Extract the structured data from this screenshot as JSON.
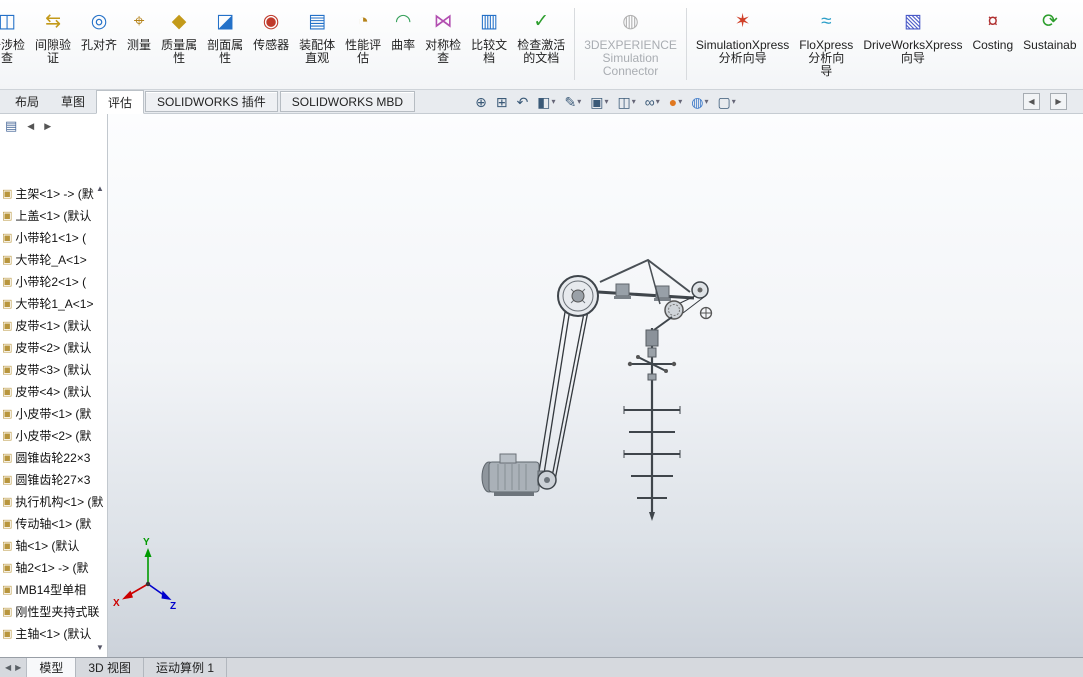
{
  "icons": {
    "scroll_up": "▲",
    "scroll_down": "▼",
    "nav_left": "◀",
    "nav_right": "▶",
    "caret": "▾",
    "collapse_left": "◀",
    "collapse_right": "▶",
    "panel_tab": "▤",
    "tree_item": "▣"
  },
  "toolbar": {
    "buttons": [
      {
        "id": "interference-check",
        "label": "干涉检\n查",
        "glyph": "◫",
        "color": "#2471c8"
      },
      {
        "id": "clearance-verification",
        "label": "间隙验\n证",
        "glyph": "⇆",
        "color": "#c39a1a"
      },
      {
        "id": "hole-alignment",
        "label": "孔对齐",
        "glyph": "◎",
        "color": "#2471c8"
      },
      {
        "id": "measure",
        "label": "测量",
        "glyph": "⌖",
        "color": "#b5831a"
      },
      {
        "id": "mass-properties",
        "label": "质量属\n性",
        "glyph": "◆",
        "color": "#c39a1a"
      },
      {
        "id": "section-properties",
        "label": "剖面属\n性",
        "glyph": "◪",
        "color": "#2471c8"
      },
      {
        "id": "sensor",
        "label": "传感器",
        "glyph": "◉",
        "color": "#c03a2b"
      },
      {
        "id": "assembly-visualization",
        "label": "装配体\n直观",
        "glyph": "▤",
        "color": "#2471c8"
      },
      {
        "id": "performance-evaluation",
        "label": "性能评\n估",
        "glyph": "◔",
        "color": "#b5831a"
      },
      {
        "id": "curvature",
        "label": "曲率",
        "glyph": "◠",
        "color": "#35a05a"
      },
      {
        "id": "symmetry-check",
        "label": "对称检\n查",
        "glyph": "⋈",
        "color": "#b24fb0"
      },
      {
        "id": "compare-documents",
        "label": "比较文\n档",
        "glyph": "▥",
        "color": "#2471c8"
      },
      {
        "id": "check-active-document",
        "label": "检查激活\n的文档",
        "glyph": "✓",
        "color": "#2d9e2d",
        "group_end": true
      },
      {
        "id": "3dexperience-simulation-connector",
        "label": "3DEXPERIENCE\nSimulation\nConnector",
        "glyph": "◍",
        "color": "#b0b0b0",
        "disabled": true,
        "group_end": true
      },
      {
        "id": "simulationxpress-wizard",
        "label": "SimulationXpress\n分析向导",
        "glyph": "✶",
        "color": "#d04028"
      },
      {
        "id": "floxpress-wizard",
        "label": "FloXpress\n分析向\n导",
        "glyph": "≈",
        "color": "#2a9ec8"
      },
      {
        "id": "driveworksxpress-wizard",
        "label": "DriveWorksXpress\n向导",
        "glyph": "▧",
        "color": "#4a5ac8"
      },
      {
        "id": "costing",
        "label": "Costing",
        "glyph": "¤",
        "color": "#b03030"
      },
      {
        "id": "sustainability",
        "label": "Sustainab",
        "glyph": "⟳",
        "color": "#2d9e2d"
      }
    ]
  },
  "command_tabs": [
    {
      "id": "layout",
      "label": "布局",
      "active": false
    },
    {
      "id": "sketch",
      "label": "草图",
      "active": false
    },
    {
      "id": "evaluate",
      "label": "评估",
      "active": true
    },
    {
      "id": "solidworks-addins",
      "label": "SOLIDWORKS 插件",
      "active": false,
      "boxed": true
    },
    {
      "id": "solidworks-mbd",
      "label": "SOLIDWORKS MBD",
      "active": false,
      "boxed": true
    }
  ],
  "view_toolbar": {
    "icons": [
      {
        "name": "zoom-fit-icon",
        "glyph": "⊕",
        "color": "#3b5a78"
      },
      {
        "name": "zoom-area-icon",
        "glyph": "⊞",
        "color": "#3b5a78"
      },
      {
        "name": "previous-view-icon",
        "glyph": "↶",
        "color": "#3b5a78"
      },
      {
        "name": "section-view-icon",
        "glyph": "◧",
        "color": "#3b5a78",
        "caret": true
      },
      {
        "name": "annotation-view-icon",
        "glyph": "✎",
        "color": "#3b5a78",
        "caret": true
      },
      {
        "name": "view-orientation-icon",
        "glyph": "▣",
        "color": "#3b5a78",
        "caret": true
      },
      {
        "name": "display-style-icon",
        "glyph": "◫",
        "color": "#3b5a78",
        "caret": true
      },
      {
        "name": "hide-show-items-icon",
        "glyph": "∞",
        "color": "#3b5a78",
        "caret": true
      },
      {
        "name": "edit-appearance-icon",
        "glyph": "●",
        "color": "#e07820",
        "caret": true
      },
      {
        "name": "apply-scene-icon",
        "glyph": "◍",
        "color": "#3a78c8",
        "caret": true
      },
      {
        "name": "view-settings-icon",
        "glyph": "▢",
        "color": "#3b5a78",
        "caret": true
      }
    ]
  },
  "sidebar": {
    "tree_items": [
      {
        "label": "主架<1> -> (默"
      },
      {
        "label": "上盖<1> (默认"
      },
      {
        "label": "小带轮1<1> ("
      },
      {
        "label": "大带轮_A<1>"
      },
      {
        "label": "小带轮2<1> ("
      },
      {
        "label": "大带轮1_A<1>"
      },
      {
        "label": "皮带<1> (默认"
      },
      {
        "label": "皮带<2> (默认"
      },
      {
        "label": "皮带<3> (默认"
      },
      {
        "label": "皮带<4> (默认"
      },
      {
        "label": "小皮带<1> (默"
      },
      {
        "label": "小皮带<2> (默"
      },
      {
        "label": "圆锥齿轮22×3"
      },
      {
        "label": "圆锥齿轮27×3"
      },
      {
        "label": "执行机构<1> (默"
      },
      {
        "label": "传动轴<1> (默"
      },
      {
        "label": "轴<1> (默认"
      },
      {
        "label": "轴2<1> -> (默"
      },
      {
        "label": "IMB14型单相"
      },
      {
        "label": "刚性型夹持式联"
      },
      {
        "label": "主轴<1> (默认"
      }
    ]
  },
  "viewport": {
    "triad": {
      "x": "X",
      "y": "Y",
      "z": "Z"
    },
    "triad_colors": {
      "x": "#cc0000",
      "y": "#009a00",
      "z": "#0000cc"
    }
  },
  "bottom_tabs": [
    {
      "id": "model",
      "label": "模型",
      "active": true
    },
    {
      "id": "3d-views",
      "label": "3D 视图",
      "active": false
    },
    {
      "id": "motion-study-1",
      "label": "运动算例 1",
      "active": false
    }
  ]
}
